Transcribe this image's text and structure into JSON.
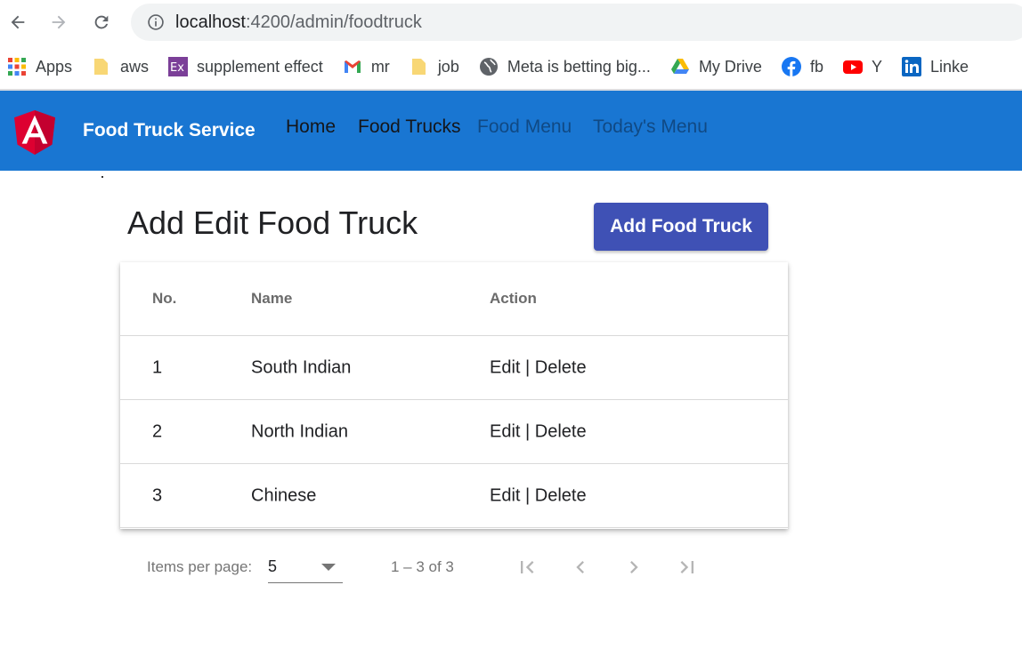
{
  "browser": {
    "url_host": "localhost",
    "url_rest": ":4200/admin/foodtruck",
    "bookmarks": [
      {
        "label": "Apps",
        "icon": "apps-grid-icon"
      },
      {
        "label": "aws",
        "icon": "folder-icon"
      },
      {
        "label": "supplement effect",
        "icon": "ex-icon"
      },
      {
        "label": "mr",
        "icon": "gmail-icon"
      },
      {
        "label": "job",
        "icon": "folder-icon"
      },
      {
        "label": "Meta is betting big...",
        "icon": "globe-icon"
      },
      {
        "label": "My Drive",
        "icon": "google-drive-icon"
      },
      {
        "label": "fb",
        "icon": "facebook-icon"
      },
      {
        "label": "Y",
        "icon": "youtube-icon"
      },
      {
        "label": "Linke",
        "icon": "linkedin-icon"
      }
    ]
  },
  "toolbar": {
    "brand": "Food Truck Service",
    "nav": [
      {
        "label": "Home",
        "active": true
      },
      {
        "label": "Food Trucks",
        "active": true
      },
      {
        "label": "Food Menu",
        "active": false
      },
      {
        "label": "Today's Menu",
        "active": false
      }
    ],
    "color": "#1976d2"
  },
  "main": {
    "title": "Add Edit Food Truck",
    "add_button": "Add Food Truck",
    "button_color": "#3f51b5",
    "table": {
      "headers": [
        "No.",
        "Name",
        "Action"
      ],
      "rows": [
        {
          "no": "1",
          "name": "South Indian",
          "action": "Edit | Delete"
        },
        {
          "no": "2",
          "name": "North Indian",
          "action": "Edit | Delete"
        },
        {
          "no": "3",
          "name": "Chinese",
          "action": "Edit | Delete"
        }
      ]
    },
    "paginator": {
      "items_per_page_label": "Items per page:",
      "page_size": "5",
      "range": "1 – 3 of 3"
    }
  }
}
